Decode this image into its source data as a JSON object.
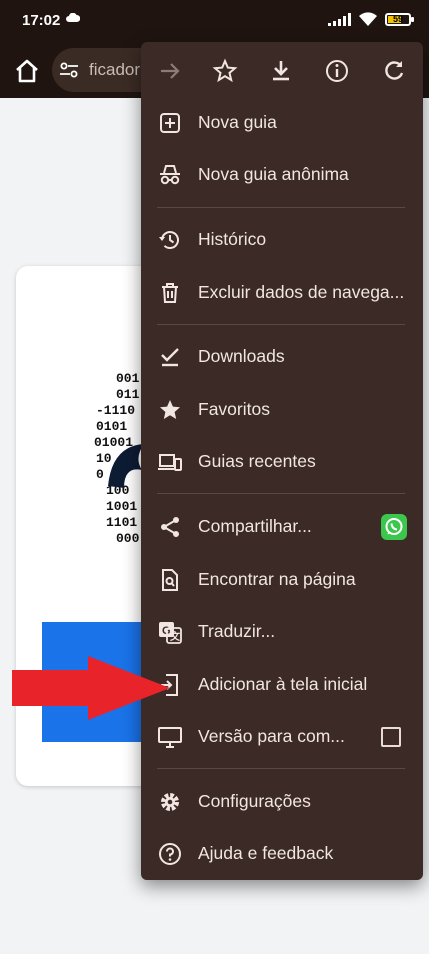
{
  "status": {
    "time": "17:02",
    "battery": "59"
  },
  "toolbar": {
    "url_fragment": "ficador"
  },
  "menu": {
    "items": [
      {
        "label": "Nova guia",
        "icon": "plus-box-icon"
      },
      {
        "label": "Nova guia anônima",
        "icon": "incognito-icon"
      },
      {
        "label": "Histórico",
        "icon": "history-icon"
      },
      {
        "label": "Excluir dados de navega...",
        "icon": "trash-icon"
      },
      {
        "label": "Downloads",
        "icon": "download-check-icon"
      },
      {
        "label": "Favoritos",
        "icon": "star-icon"
      },
      {
        "label": "Guias recentes",
        "icon": "devices-icon"
      },
      {
        "label": "Compartilhar...",
        "icon": "share-icon"
      },
      {
        "label": "Encontrar na página",
        "icon": "find-in-page-icon"
      },
      {
        "label": "Traduzir...",
        "icon": "translate-icon"
      },
      {
        "label": "Adicionar à tela inicial",
        "icon": "add-to-home-icon"
      },
      {
        "label": "Versão para com...",
        "icon": "desktop-icon"
      },
      {
        "label": "Configurações",
        "icon": "gear-icon"
      },
      {
        "label": "Ajuda e feedback",
        "icon": "help-icon"
      }
    ]
  },
  "logo_digits": [
    "001",
    "011",
    "-1110",
    "0101",
    "01001",
    "10",
    "0",
    "100",
    "1001",
    "1101",
    "000"
  ],
  "colors": {
    "menu_bg": "#3b2a25",
    "toolbar_bg": "#1f1410",
    "arrow": "#e8232a",
    "whatsapp": "#3cc64e",
    "button_blue": "#1a73e8"
  }
}
